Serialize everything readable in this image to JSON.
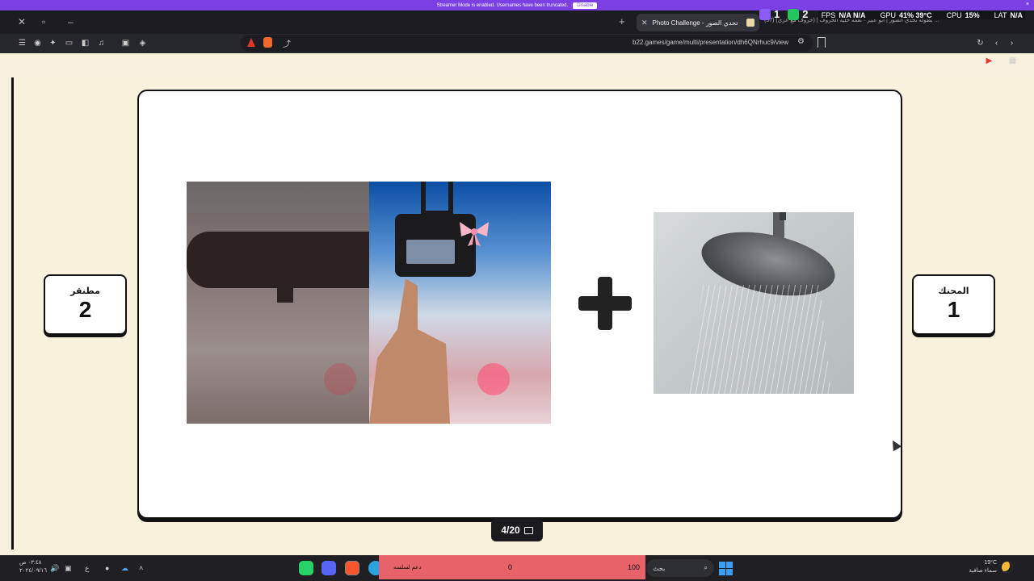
{
  "banner": {
    "text": "Streamer Mode is enabled. Usernames have been truncated.",
    "disable_label": "Disable",
    "close": "×"
  },
  "tabs": {
    "active_title": "Photo Challenge - تحدي الصور",
    "other_tabs_text": "(37) بطولة تحدي الصور | أبو عبير  ·  تعمة خلية الحروف | (حروف مع عزي) ...",
    "new_tab": "+"
  },
  "overlay": {
    "score_a": "1",
    "score_b": "2",
    "fps_label": "FPS",
    "fps_value": "N/A  N/A",
    "gpu_label": "GPU",
    "gpu_value": "41% 39°C",
    "cpu_label": "CPU",
    "cpu_value": "15%",
    "lat_label": "LAT",
    "lat_value": "N/A"
  },
  "address_bar": {
    "url": "b22.games/game/multi/presentation/dh6QNrhuc9/view"
  },
  "game": {
    "team_left": {
      "name": "مطنقر",
      "score": "2"
    },
    "team_right": {
      "name": "المحنك",
      "score": "1"
    },
    "progress": "4/20"
  },
  "taskbar": {
    "search_placeholder": "بحث",
    "donation_label": "دعم لسلسه",
    "donation_value": "0",
    "donation_max": "100",
    "weather_temp": "19°C",
    "weather_desc": "سماء صافية",
    "clock_time": "٠٣:٤٨ ص",
    "clock_date": "٢٠٢٤/٠٩/١٦",
    "lang": "ع"
  },
  "colors": {
    "banner": "#7b3fe4",
    "page_bg": "#f6f0dc",
    "donation_bar": "#e8626a"
  }
}
